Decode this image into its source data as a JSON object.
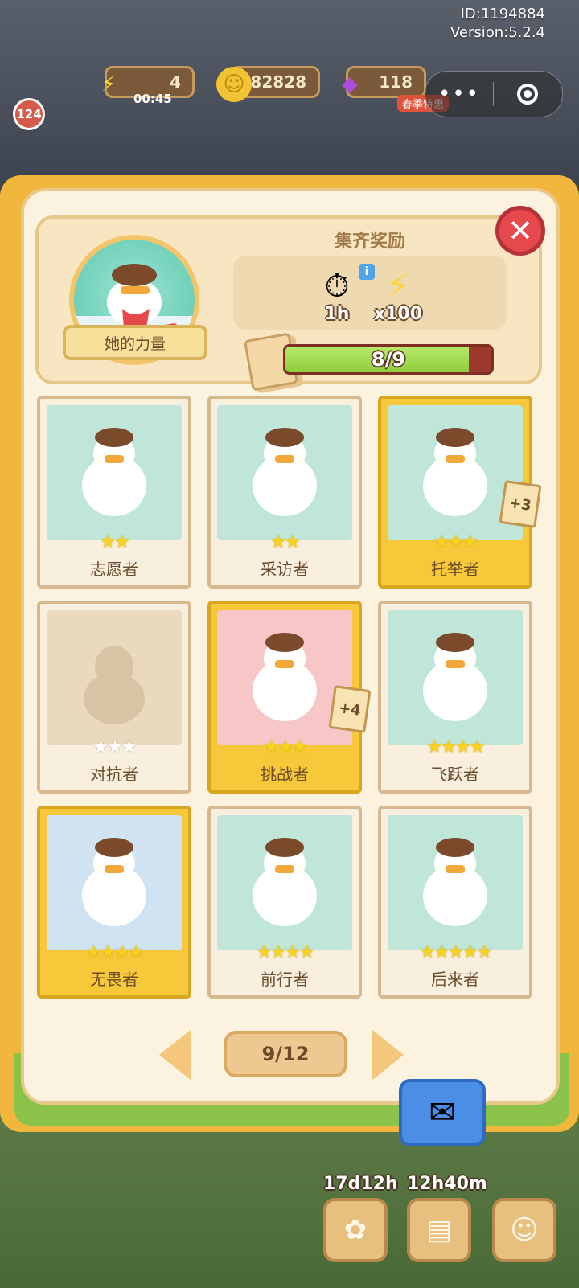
{
  "meta": {
    "id": "ID:1194884",
    "version": "Version:5.2.4"
  },
  "topbar": {
    "level": "124",
    "energy": {
      "value": "4",
      "timer": "00:45"
    },
    "coins": "182828",
    "gems": "118",
    "event_label": "春季特惠"
  },
  "header": {
    "collection_name": "她的力量",
    "reward_title": "集齐奖励",
    "rewards": [
      {
        "icon": "stopwatch-icon",
        "label": "1h"
      },
      {
        "icon": "lightning-icon",
        "label": "x100"
      }
    ],
    "progress": {
      "text": "8/9",
      "collected": 8,
      "total": 9
    }
  },
  "cards": [
    {
      "name": "志愿者",
      "stars": "★★",
      "locked": false,
      "gold": false
    },
    {
      "name": "采访者",
      "stars": "★★",
      "locked": false,
      "gold": false
    },
    {
      "name": "托举者",
      "stars": "★★★",
      "locked": false,
      "gold": true,
      "badge": "+3"
    },
    {
      "name": "对抗者",
      "stars": "★★★",
      "locked": true,
      "gold": false
    },
    {
      "name": "挑战者",
      "stars": "★★★",
      "locked": false,
      "gold": true,
      "badge": "+4"
    },
    {
      "name": "飞跃者",
      "stars": "★★★★",
      "locked": false,
      "gold": false
    },
    {
      "name": "无畏者",
      "stars": "★★★★",
      "locked": false,
      "gold": true
    },
    {
      "name": "前行者",
      "stars": "★★★★",
      "locked": false,
      "gold": false
    },
    {
      "name": "后来者",
      "stars": "★★★★★",
      "locked": false,
      "gold": false
    }
  ],
  "pagination": {
    "text": "9/12"
  },
  "bottom": {
    "timer1": "17d12h",
    "timer2": "12h40m"
  },
  "colors": {
    "accent": "#f0b73c",
    "close": "#e5484d",
    "progress_fill": "#8fce3c"
  }
}
